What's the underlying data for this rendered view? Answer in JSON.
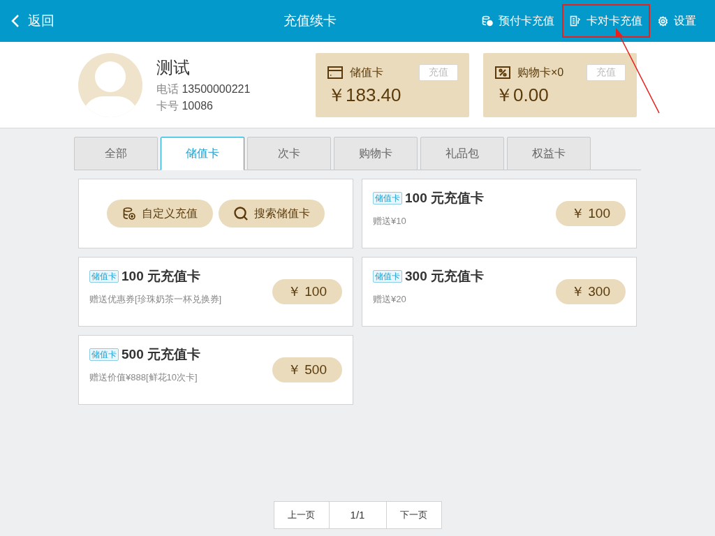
{
  "header": {
    "back": "返回",
    "title": "充值续卡",
    "actions": [
      {
        "kind": "prepaid",
        "label": "预付卡充值",
        "highlighted": false
      },
      {
        "kind": "transfer",
        "label": "卡对卡充值",
        "highlighted": true
      },
      {
        "kind": "settings",
        "label": "设置",
        "highlighted": false
      }
    ]
  },
  "member": {
    "name": "测试",
    "phone_label": "电话",
    "phone": "13500000221",
    "card_label": "卡号",
    "card": "10086"
  },
  "balances": [
    {
      "kind": "stored",
      "label": "储值卡",
      "amount": "￥183.40",
      "button": "充值"
    },
    {
      "kind": "shopping",
      "label": "购物卡×0",
      "amount": "￥0.00",
      "button": "充值"
    }
  ],
  "tabs": [
    {
      "label": "全部",
      "selected": false
    },
    {
      "label": "储值卡",
      "selected": true
    },
    {
      "label": "次卡",
      "selected": false
    },
    {
      "label": "购物卡",
      "selected": false
    },
    {
      "label": "礼品包",
      "selected": false
    },
    {
      "label": "权益卡",
      "selected": false
    }
  ],
  "actions": [
    {
      "kind": "custom",
      "label": "自定义充值"
    },
    {
      "kind": "search",
      "label": "搜索储值卡"
    }
  ],
  "products": [
    {
      "tag": "储值卡",
      "title": "100 元充值卡",
      "bonus": "赠送¥10",
      "price": "￥ 100"
    },
    {
      "tag": "储值卡",
      "title": "100 元充值卡",
      "bonus": "赠送优惠券[珍珠奶茶一杯兑换券]",
      "price": "￥ 100"
    },
    {
      "tag": "储值卡",
      "title": "300 元充值卡",
      "bonus": "赠送¥20",
      "price": "￥ 300"
    },
    {
      "tag": "储值卡",
      "title": "500 元充值卡",
      "bonus": "赠送价值¥888[鲜花10次卡]",
      "price": "￥ 500"
    }
  ],
  "pagination": {
    "prev": "上一页",
    "page": "1/1",
    "next": "下一页"
  }
}
